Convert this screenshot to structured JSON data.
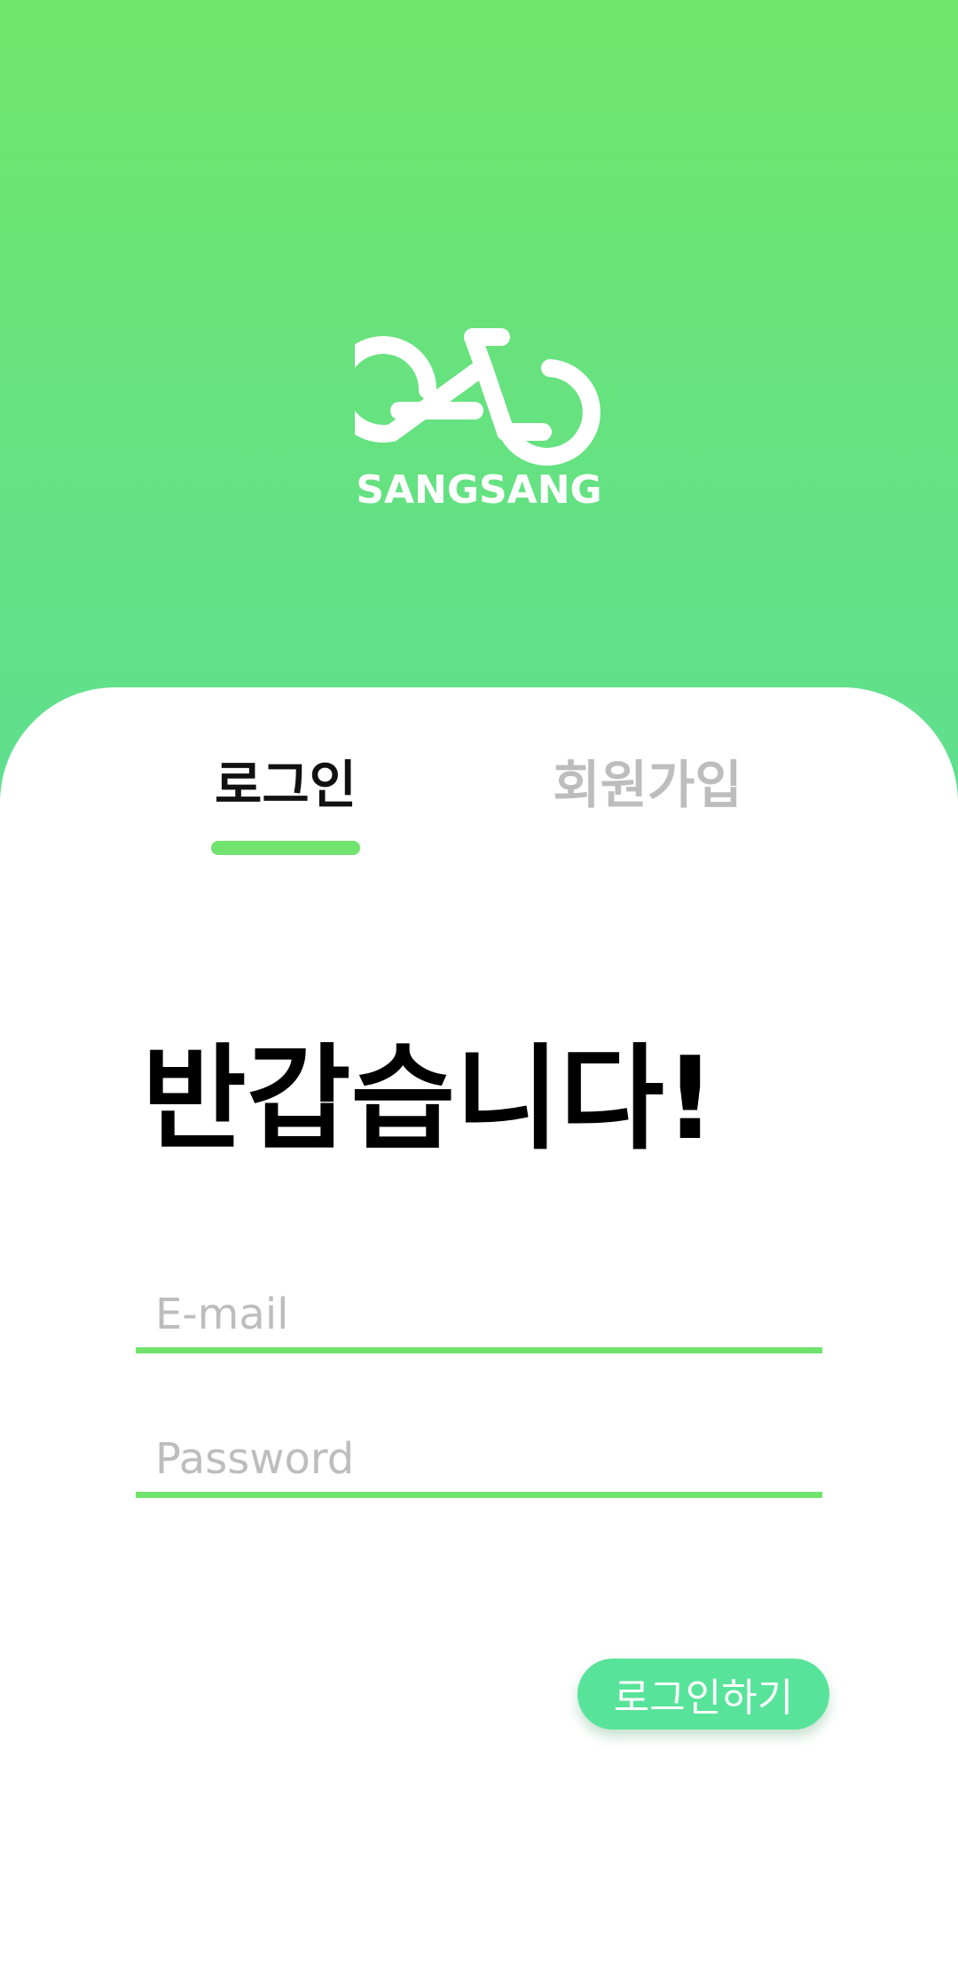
{
  "brand": {
    "name": "SANGSANG",
    "logo_icon": "bicycle-icon",
    "colors": {
      "primary_green": "#72e66a",
      "secondary_green": "#5fe08f",
      "button_green": "#58e39a",
      "inactive_gray": "#bdbdbd"
    }
  },
  "tabs": {
    "login_label": "로그인",
    "signup_label": "회원가입",
    "active": "로그인"
  },
  "greeting": "반갑습니다!",
  "form": {
    "email_placeholder": "E-mail",
    "password_placeholder": "Password",
    "submit_label": "로그인하기"
  }
}
